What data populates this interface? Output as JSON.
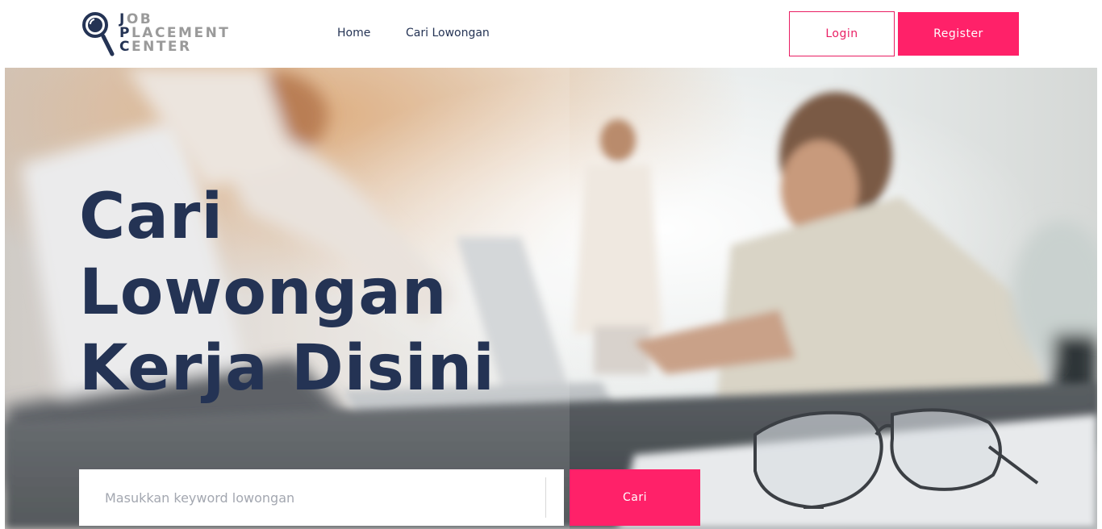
{
  "colors": {
    "brand_navy": "#243354",
    "accent_pink": "#ff2169",
    "logo_gray": "#9a9a9a"
  },
  "logo": {
    "line1": {
      "initial": "J",
      "rest": "OB"
    },
    "line2": {
      "initial": "P",
      "rest": "LACEMENT"
    },
    "line3": {
      "initial": "C",
      "rest": "ENTER"
    },
    "icon": "magnifier-icon"
  },
  "nav": {
    "home": "Home",
    "cari_lowongan": "Cari Lowongan"
  },
  "auth": {
    "login": "Login",
    "register": "Register"
  },
  "hero": {
    "title_line1": "Cari",
    "title_line2": "Lowongan",
    "title_line3": "Kerja Disini"
  },
  "search": {
    "placeholder": "Masukkan keyword lowongan",
    "value": "",
    "button": "Cari"
  }
}
